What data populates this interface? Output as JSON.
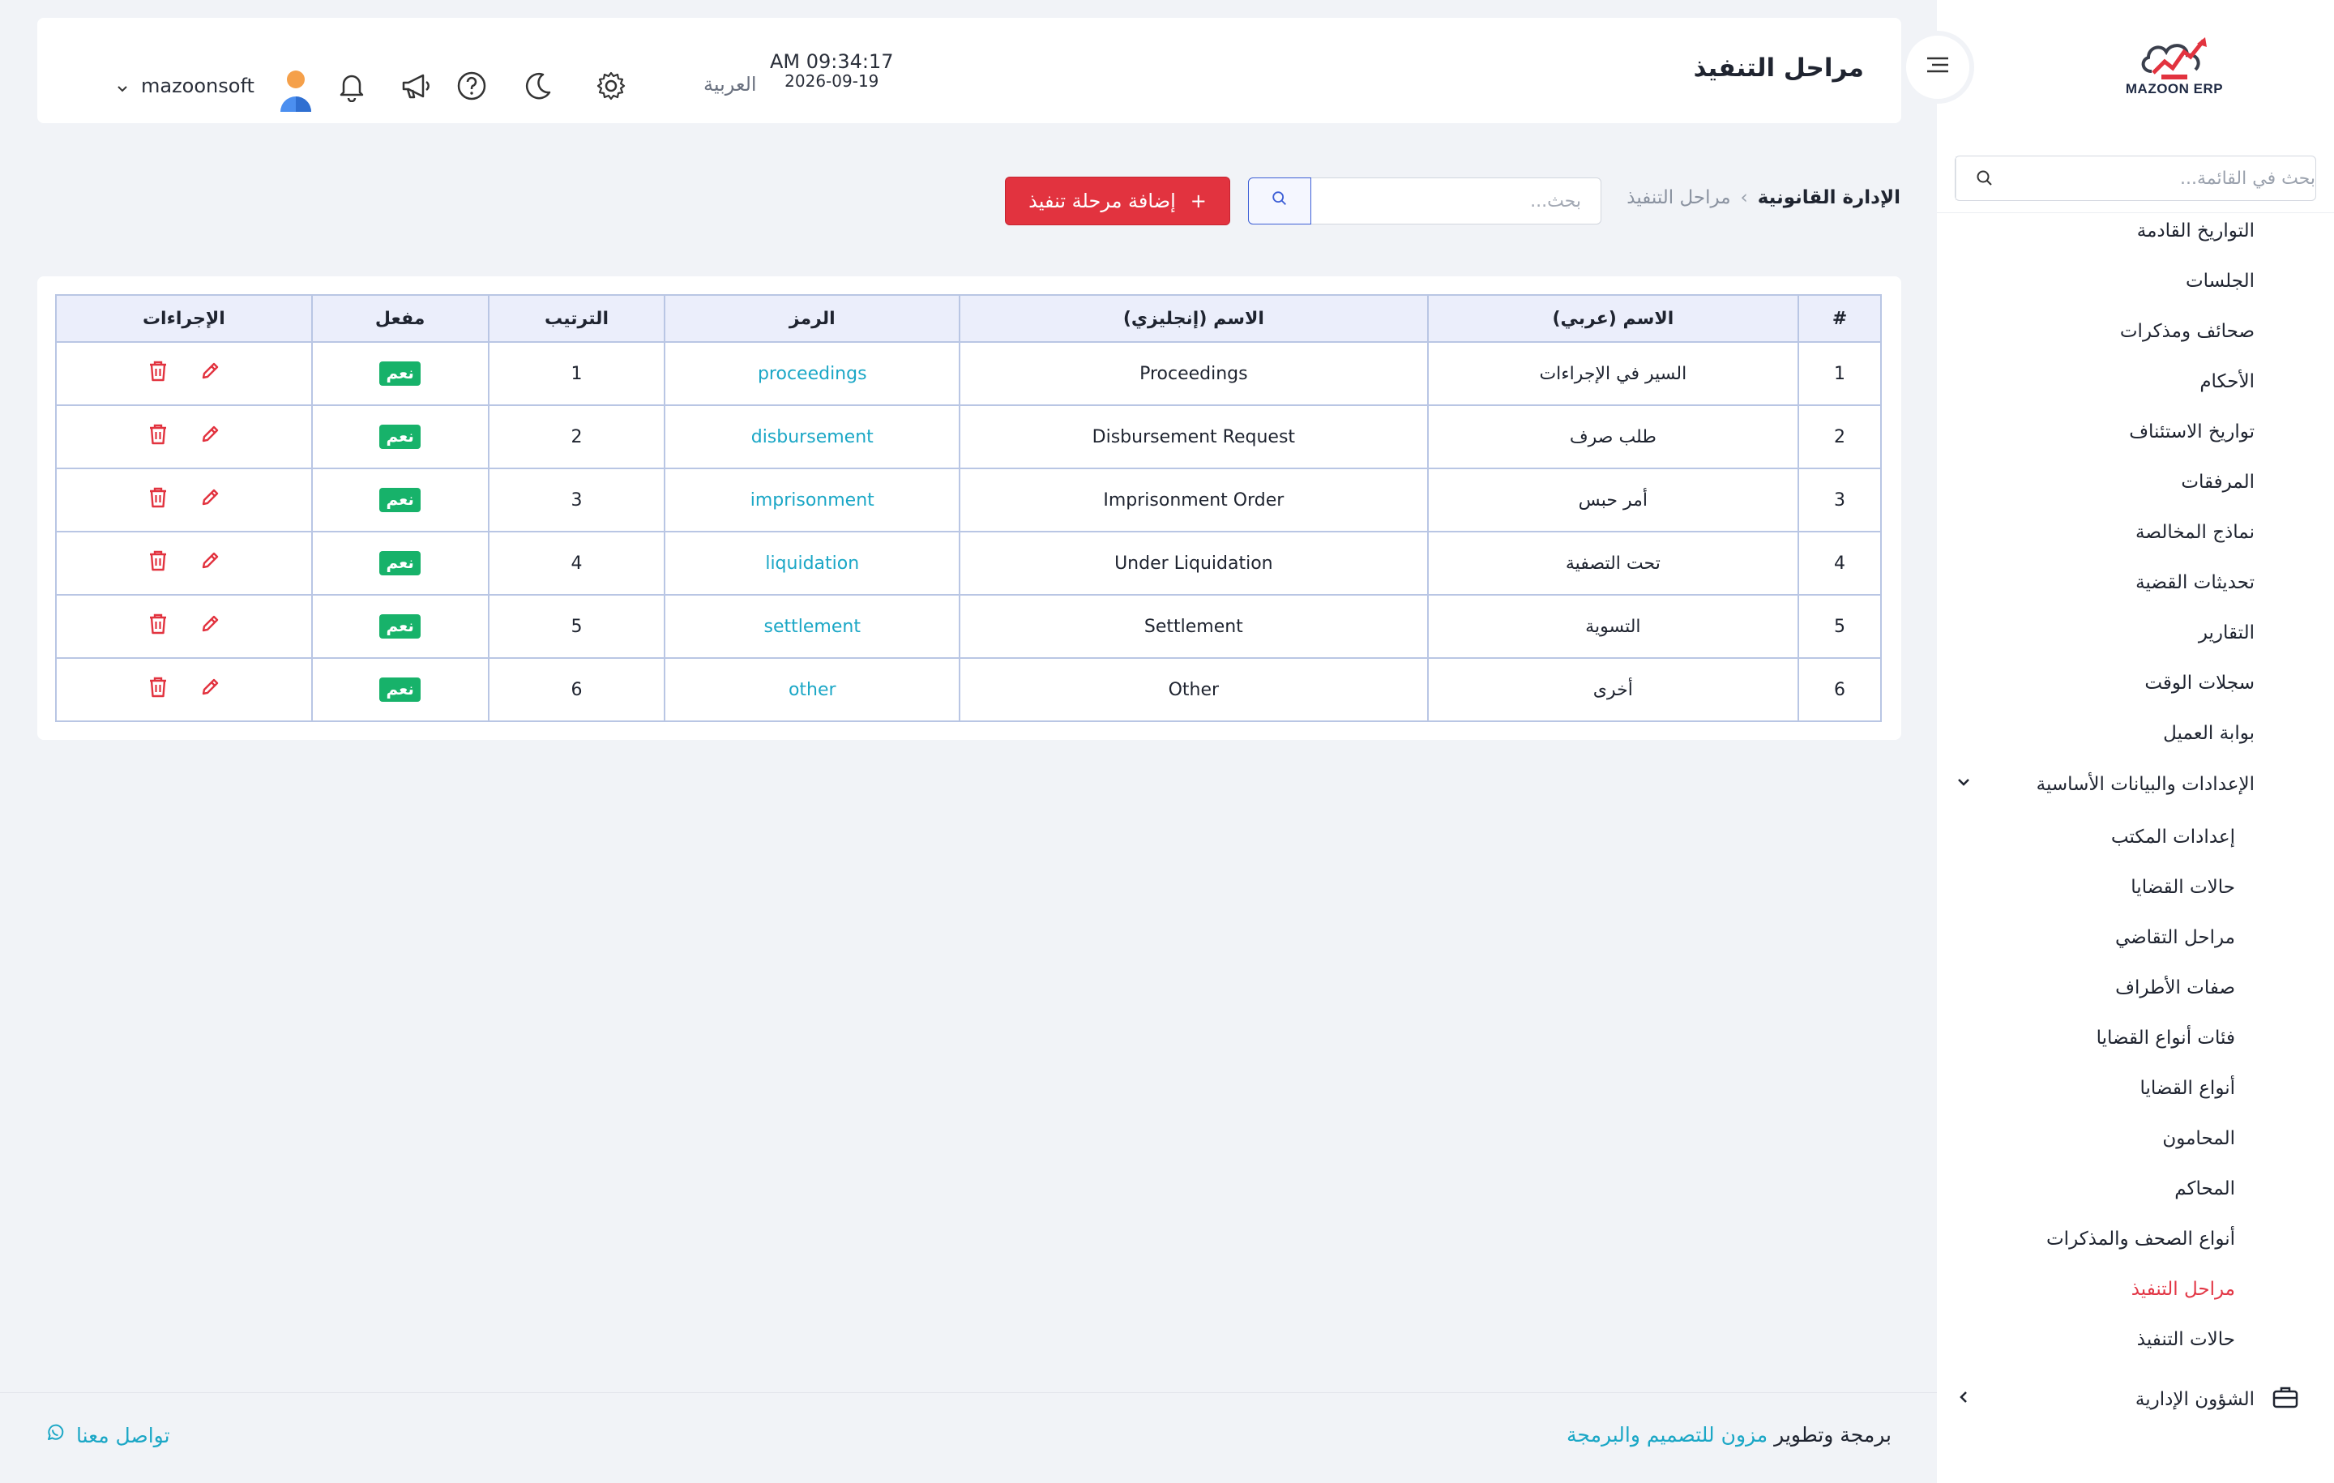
{
  "app": {
    "logo_text": "MAZOON ERP",
    "brand_color": "#e2333f",
    "accent_color": "#1ba7c6"
  },
  "sidebar": {
    "search_placeholder": "بحث في القائمة...",
    "items": [
      {
        "label": "التواريخ القادمة"
      },
      {
        "label": "الجلسات"
      },
      {
        "label": "صحائف ومذكرات"
      },
      {
        "label": "الأحكام"
      },
      {
        "label": "تواريخ الاستئناف"
      },
      {
        "label": "المرفقات"
      },
      {
        "label": "نماذج المخالصة"
      },
      {
        "label": "تحديثات القضية"
      },
      {
        "label": "التقارير"
      },
      {
        "label": "سجلات الوقت"
      },
      {
        "label": "بوابة العميل"
      }
    ],
    "group": {
      "label": "الإعدادات والبيانات الأساسية",
      "icon": "chevron-down-icon",
      "children": [
        {
          "label": "إعدادات المكتب"
        },
        {
          "label": "حالات القضايا"
        },
        {
          "label": "مراحل التقاضي"
        },
        {
          "label": "صفات الأطراف"
        },
        {
          "label": "فئات أنواع القضايا"
        },
        {
          "label": "أنواع القضايا"
        },
        {
          "label": "المحامون"
        },
        {
          "label": "المحاكم"
        },
        {
          "label": "أنواع الصحف والمذكرات"
        },
        {
          "label": "مراحل التنفيذ"
        },
        {
          "label": "حالات التنفيذ"
        }
      ],
      "active_index": 9
    },
    "footer_item": {
      "label": "الشؤون الإدارية",
      "icon": "briefcase-icon"
    }
  },
  "header": {
    "title": "مراحل التنفيذ",
    "time": "AM 09:34:17",
    "date": "2026-09-19",
    "language": "العربية",
    "username": "mazoonsoft",
    "icons": [
      "menu-icon",
      "settings-icon",
      "moon-icon",
      "help-icon",
      "megaphone-icon",
      "bell-icon",
      "avatar",
      "chevron-down-icon"
    ]
  },
  "toolbar": {
    "breadcrumb_root": "الإدارة القانونية",
    "breadcrumb_separator": "›",
    "breadcrumb_current": "مراحل التنفيذ",
    "search_placeholder": "بحث...",
    "add_button": "إضافة مرحلة تنفيذ",
    "add_button_icon": "+"
  },
  "table": {
    "columns": [
      "#",
      "الاسم (عربي)",
      "الاسم (إنجليزي)",
      "الرمز",
      "الترتيب",
      "مفعل",
      "الإجراءات"
    ],
    "rows": [
      {
        "num": "1",
        "name_ar": "السير في الإجراءات",
        "name_en": "Proceedings",
        "code": "proceedings",
        "order": "1",
        "enabled": "نعم"
      },
      {
        "num": "2",
        "name_ar": "طلب صرف",
        "name_en": "Disbursement Request",
        "code": "disbursement",
        "order": "2",
        "enabled": "نعم"
      },
      {
        "num": "3",
        "name_ar": "أمر حبس",
        "name_en": "Imprisonment Order",
        "code": "imprisonment",
        "order": "3",
        "enabled": "نعم"
      },
      {
        "num": "4",
        "name_ar": "تحت التصفية",
        "name_en": "Under Liquidation",
        "code": "liquidation",
        "order": "4",
        "enabled": "نعم"
      },
      {
        "num": "5",
        "name_ar": "التسوية",
        "name_en": "Settlement",
        "code": "settlement",
        "order": "5",
        "enabled": "نعم"
      },
      {
        "num": "6",
        "name_ar": "أخرى",
        "name_en": "Other",
        "code": "other",
        "order": "6",
        "enabled": "نعم"
      }
    ]
  },
  "footer": {
    "credit_prefix": "برمجة وتطوير",
    "credit_brand": "مزون للتصميم والبرمجة",
    "contact": "تواصل معنا",
    "contact_icon": "whatsapp-icon"
  }
}
